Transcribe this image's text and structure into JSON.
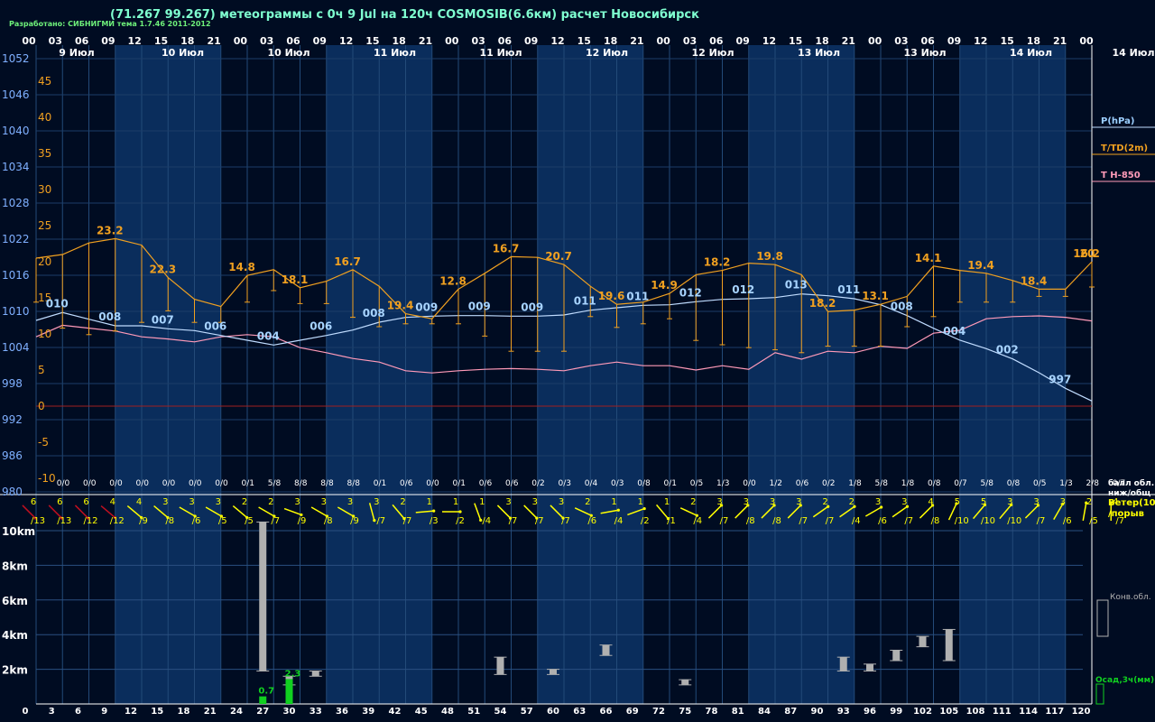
{
  "title": "(71.267 99.267) метеограммы с  0ч 9 Jul на 120ч COSMOSIB(6.6км) расчет Новосибирск",
  "credit": "Разработано: СИБНИГМИ тема 1.7.46 2011-2012",
  "colors": {
    "background": "#000c22",
    "dayband": "#0a2d5c",
    "pressure": "#c0dcff",
    "temperature": "#f0a020",
    "t850": "#ff9ab8",
    "wind": "#ffff00",
    "wind_strong": "#c01020",
    "cloud": "#b0b0b0",
    "precip": "#10d020",
    "zero_line": "#a02020"
  },
  "top_axis": {
    "hour_labels": [
      "00",
      "03",
      "06",
      "09",
      "12",
      "15",
      "18",
      "21",
      "00",
      "03",
      "06",
      "09",
      "12",
      "15",
      "18",
      "21",
      "00",
      "03",
      "06",
      "09",
      "12",
      "15",
      "18",
      "21",
      "00",
      "03",
      "06",
      "09",
      "12",
      "15",
      "18",
      "21",
      "00",
      "03",
      "06",
      "09",
      "12",
      "15",
      "18",
      "21",
      "00"
    ],
    "date_labels": [
      "9 Июл",
      "10 Июл",
      "10 Июл",
      "11 Июл",
      "11 Июл",
      "12 Июл",
      "12 Июл",
      "13 Июл",
      "13 Июл",
      "14 Июл"
    ],
    "right_date": "14 Июл"
  },
  "bottom_axis": {
    "hour_labels": [
      "0",
      "3",
      "6",
      "9",
      "12",
      "15",
      "18",
      "21",
      "24",
      "27",
      "30",
      "33",
      "36",
      "39",
      "42",
      "45",
      "48",
      "51",
      "54",
      "57",
      "60",
      "63",
      "66",
      "69",
      "72",
      "75",
      "78",
      "81",
      "84",
      "87",
      "90",
      "93",
      "96",
      "99",
      "102",
      "105",
      "108",
      "111",
      "114",
      "117",
      "120"
    ]
  },
  "chart_data": {
    "type": "line",
    "x_hours": [
      0,
      3,
      6,
      9,
      12,
      15,
      18,
      21,
      24,
      27,
      30,
      33,
      36,
      39,
      42,
      45,
      48,
      51,
      54,
      57,
      60,
      63,
      66,
      69,
      72,
      75,
      78,
      81,
      84,
      87,
      90,
      93,
      96,
      99,
      102,
      105,
      108,
      111,
      114,
      117,
      120
    ],
    "pressure_axis": {
      "ticks": [
        1052,
        1046,
        1040,
        1034,
        1028,
        1022,
        1016,
        1010,
        1004,
        998,
        992,
        986,
        980
      ],
      "label": "P(hPa)"
    },
    "temperature_axis": {
      "ticks": [
        45,
        40,
        35,
        30,
        25,
        20,
        15,
        10,
        5,
        0,
        -5,
        -10
      ],
      "label": "T/TD(2m)"
    },
    "t850_label": "T H-850",
    "pressure_hpa": [
      1008.5,
      1009.8,
      1008.7,
      1007.6,
      1007.6,
      1007.1,
      1006.8,
      1006,
      1005.2,
      1004.4,
      1005.2,
      1006,
      1006.9,
      1008.2,
      1009,
      1009.2,
      1009.3,
      1009.3,
      1009.2,
      1009.2,
      1009.4,
      1010.2,
      1010.6,
      1011,
      1011.1,
      1011.6,
      1012,
      1012.1,
      1012.3,
      1012.9,
      1012.6,
      1012.1,
      1011.1,
      1009.3,
      1007.2,
      1005.2,
      1003.8,
      1002.1,
      999.8,
      997.2,
      995.1
    ],
    "pressure_labels": [
      {
        "h": 3,
        "text": "010"
      },
      {
        "h": 9,
        "text": "008"
      },
      {
        "h": 15,
        "text": "007"
      },
      {
        "h": 21,
        "text": "006"
      },
      {
        "h": 27,
        "text": "004"
      },
      {
        "h": 33,
        "text": "006"
      },
      {
        "h": 39,
        "text": "008"
      },
      {
        "h": 45,
        "text": "009"
      },
      {
        "h": 51,
        "text": "009"
      },
      {
        "h": 57,
        "text": "009"
      },
      {
        "h": 63,
        "text": "011"
      },
      {
        "h": 69,
        "text": "011"
      },
      {
        "h": 75,
        "text": "012"
      },
      {
        "h": 81,
        "text": "012"
      },
      {
        "h": 87,
        "text": "013"
      },
      {
        "h": 93,
        "text": "011"
      },
      {
        "h": 99,
        "text": "008"
      },
      {
        "h": 105,
        "text": "004"
      },
      {
        "h": 111,
        "text": "002"
      },
      {
        "h": 117,
        "text": "997"
      }
    ],
    "temperature_c": [
      20.5,
      21,
      22.6,
      23.2,
      22.3,
      17.8,
      14.8,
      13.8,
      18.1,
      18.9,
      16.4,
      17.3,
      18.9,
      16.6,
      12.8,
      12.1,
      16.2,
      18.4,
      20.7,
      20.6,
      19.6,
      16.6,
      14.1,
      14.4,
      15.6,
      18.2,
      18.8,
      19.8,
      19.6,
      18.2,
      13.1,
      13.3,
      14.1,
      15.2,
      19.4,
      18.8,
      18.4,
      17.4,
      16.2,
      16.2,
      20.0
    ],
    "dewpoint_c": [
      14.4,
      10.8,
      9.9,
      10.4,
      11.6,
      13.2,
      11.6,
      11.6,
      14.4,
      16.0,
      14.2,
      14.2,
      12.3,
      11.0,
      11.4,
      11.4,
      11.4,
      9.7,
      7.6,
      7.6,
      7.6,
      12.4,
      10.9,
      11.4,
      12.1,
      9.1,
      8.5,
      8.1,
      7.8,
      7.4,
      8.3,
      8.3,
      8.3,
      11.0,
      12.4,
      14.4,
      14.4,
      14.4,
      15.2,
      15.2,
      16.5
    ],
    "temperature_labels": [
      {
        "h": 9,
        "text": "23.2"
      },
      {
        "h": 15,
        "text": "22.3"
      },
      {
        "h": 24,
        "text": "14.8"
      },
      {
        "h": 30,
        "text": "18.1"
      },
      {
        "h": 36,
        "text": "16.7"
      },
      {
        "h": 42,
        "text": "19.4"
      },
      {
        "h": 48,
        "text": "12.8"
      },
      {
        "h": 54,
        "text": "16.7"
      },
      {
        "h": 60,
        "text": "20.7"
      },
      {
        "h": 66,
        "text": "19.6"
      },
      {
        "h": 72,
        "text": "14.9"
      },
      {
        "h": 78,
        "text": "18.2"
      },
      {
        "h": 84,
        "text": "19.8"
      },
      {
        "h": 90,
        "text": "18.2"
      },
      {
        "h": 96,
        "text": "13.1"
      },
      {
        "h": 102,
        "text": "14.1"
      },
      {
        "h": 108,
        "text": "19.4"
      },
      {
        "h": 114,
        "text": "18.4"
      },
      {
        "h": 120,
        "text": "16.2"
      },
      {
        "h": 126,
        "text": "20"
      }
    ],
    "t850_c": [
      9.6,
      11.2,
      10.8,
      10.4,
      9.6,
      9.3,
      8.9,
      9.6,
      9.9,
      9.6,
      8.1,
      7.4,
      6.6,
      6.1,
      4.9,
      4.6,
      4.9,
      5.1,
      5.2,
      5.1,
      4.9,
      5.6,
      6.1,
      5.6,
      5.6,
      5.0,
      5.6,
      5.1,
      7.4,
      6.5,
      7.6,
      7.4,
      8.3,
      8.0,
      10.1,
      10.5,
      12.1,
      12.4,
      12.5,
      12.3,
      11.8
    ],
    "cloud_cover": [
      "0/0",
      "0/0",
      "0/0",
      "0/0",
      "0/0",
      "0/0",
      "0/0",
      "0/1",
      "5/8",
      "8/8",
      "8/8",
      "8/8",
      "0/1",
      "0/6",
      "0/0",
      "0/1",
      "0/6",
      "0/6",
      "0/2",
      "0/3",
      "0/4",
      "0/3",
      "0/8",
      "0/1",
      "0/5",
      "1/3",
      "0/0",
      "1/2",
      "0/6",
      "0/2",
      "1/8",
      "5/8",
      "1/8",
      "0/8",
      "0/7",
      "5/8",
      "0/8",
      "0/5",
      "1/3",
      "2/8",
      "0/7"
    ],
    "cloud_cover_label": "балл обл. ниж/общ",
    "wind_speed": [
      6,
      6,
      6,
      4,
      4,
      3,
      3,
      3,
      2,
      2,
      3,
      3,
      3,
      3,
      2,
      1,
      1,
      1,
      3,
      3,
      3,
      2,
      1,
      1,
      1,
      2,
      3,
      3,
      3,
      3,
      2,
      2,
      3,
      3,
      4,
      5,
      5,
      3,
      3,
      3,
      2,
      4
    ],
    "wind_gust": [
      13,
      13,
      12,
      12,
      9,
      8,
      6,
      5,
      5,
      7,
      9,
      8,
      9,
      7,
      7,
      3,
      2,
      4,
      7,
      7,
      7,
      6,
      4,
      2,
      1,
      4,
      7,
      8,
      8,
      7,
      7,
      4,
      6,
      7,
      8,
      10,
      10,
      10,
      7,
      6,
      5,
      7
    ],
    "wind_dir_deg": [
      315,
      315,
      315,
      310,
      310,
      310,
      300,
      300,
      310,
      300,
      290,
      300,
      300,
      345,
      320,
      265,
      270,
      340,
      315,
      315,
      315,
      295,
      260,
      250,
      320,
      295,
      225,
      225,
      225,
      225,
      235,
      235,
      240,
      235,
      225,
      205,
      220,
      220,
      225,
      210,
      190,
      180
    ],
    "wind_label_1": "Ветер(10м)",
    "wind_label_2": "/порыв",
    "km_axis": {
      "ticks": [
        "10km",
        "8km",
        "6km",
        "4km",
        "2km"
      ]
    },
    "convective_clouds": [
      {
        "h": 27,
        "base_km": 1.9,
        "top_km": 10.5
      },
      {
        "h": 30,
        "base_km": 1.1,
        "top_km": 1.6
      },
      {
        "h": 33,
        "base_km": 1.6,
        "top_km": 1.9
      },
      {
        "h": 54,
        "base_km": 1.7,
        "top_km": 2.7
      },
      {
        "h": 60,
        "base_km": 1.7,
        "top_km": 2.0
      },
      {
        "h": 66,
        "base_km": 2.8,
        "top_km": 3.4
      },
      {
        "h": 75,
        "base_km": 1.1,
        "top_km": 1.4
      },
      {
        "h": 93,
        "base_km": 1.9,
        "top_km": 2.7
      },
      {
        "h": 96,
        "base_km": 1.9,
        "top_km": 2.3
      },
      {
        "h": 99,
        "base_km": 2.5,
        "top_km": 3.1
      },
      {
        "h": 102,
        "base_km": 3.3,
        "top_km": 3.9
      },
      {
        "h": 105,
        "base_km": 2.5,
        "top_km": 4.3
      }
    ],
    "convective_label": "Конв.обл.",
    "precip_mm": [
      {
        "h": 27,
        "value": 0.7,
        "label": "0.7"
      },
      {
        "h": 30,
        "value": 2.3,
        "label": "2.3"
      }
    ],
    "precip_label": "Осад,3ч(мм)"
  }
}
